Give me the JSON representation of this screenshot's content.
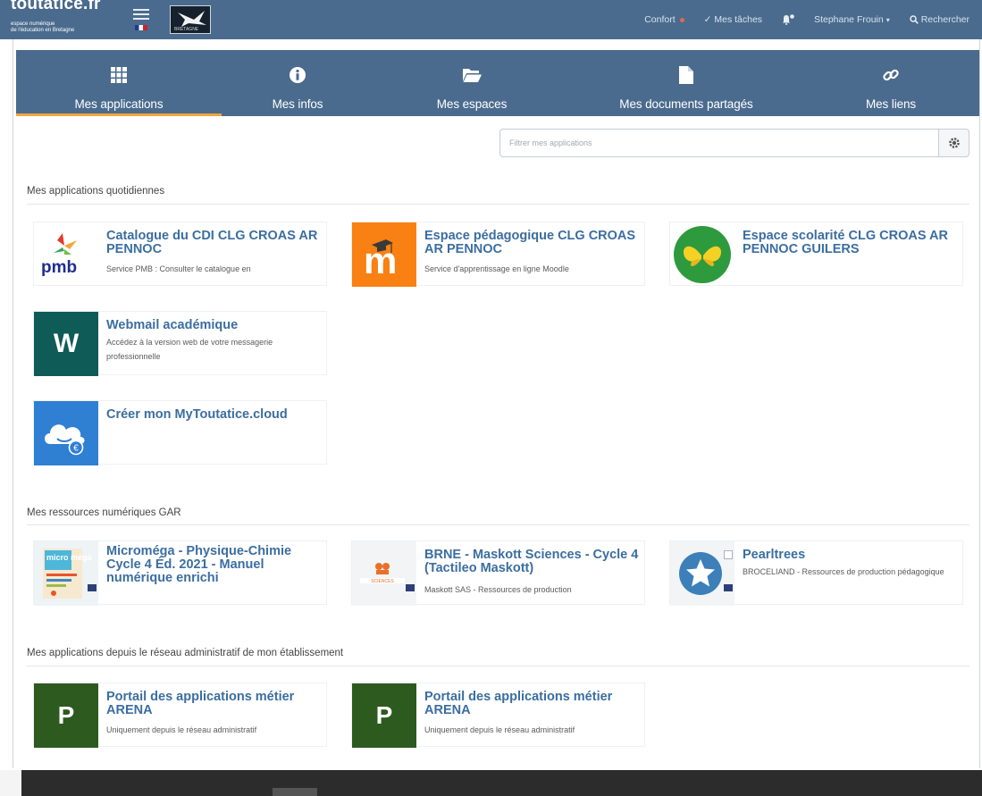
{
  "header": {
    "logo_title": "toutatice.fr",
    "logo_sub1": "espace numérique",
    "logo_sub2": "de l'éducation en Bretagne",
    "bretagne_label": "BRETAGNE",
    "comfort_label": "Confort",
    "tasks_label": "✓ Mes tâches",
    "user_label": "Stephane Frouin",
    "search_label": "Rechercher"
  },
  "tabs": [
    {
      "label": "Mes applications",
      "icon": "grid-icon",
      "active": true
    },
    {
      "label": "Mes infos",
      "icon": "info-icon",
      "active": false
    },
    {
      "label": "Mes espaces",
      "icon": "folder-open-icon",
      "active": false
    },
    {
      "label": "Mes documents partagés",
      "icon": "file-icon",
      "active": false
    },
    {
      "label": "Mes liens",
      "icon": "link-icon",
      "active": false
    }
  ],
  "filter": {
    "placeholder": "Filtrer mes applications"
  },
  "sections": {
    "daily": {
      "title": "Mes applications quotidiennes",
      "cards": [
        {
          "title": "Catalogue du CDI CLG CROAS AR PENNOC",
          "desc": "Service PMB : Consulter le catalogue en",
          "thumb_text": "pmb"
        },
        {
          "title": "Espace pédagogique CLG CROAS AR PENNOC",
          "desc": "Service d'apprentissage en ligne Moodle",
          "thumb_text": "m"
        },
        {
          "title": "Espace scolarité CLG CROAS AR PENNOC GUILERS",
          "desc": "",
          "thumb_text": ""
        },
        {
          "title": "Webmail académique",
          "desc": "Accédez à la version web de votre messagerie professionnelle",
          "thumb_text": "W"
        },
        {
          "title": "Créer mon MyToutatice.cloud",
          "desc": "",
          "thumb_text": "€"
        }
      ]
    },
    "gar": {
      "title": "Mes ressources numériques GAR",
      "cards": [
        {
          "title": "Microméga - Physique-Chimie Cycle 4 Éd. 2021 - Manuel numérique enrichi",
          "desc": "",
          "thumb_text": "micro méga"
        },
        {
          "title": "BRNE - Maskott Sciences - Cycle 4 (Tactileo Maskott)",
          "desc": "Maskott SAS - Ressources de production",
          "thumb_text": "SCIENCES"
        },
        {
          "title": "Pearltrees",
          "desc": "BROCELIAND - Ressources de production pédagogique",
          "thumb_text": ""
        }
      ]
    },
    "admin": {
      "title": "Mes applications depuis le réseau administratif de mon établissement",
      "cards": [
        {
          "title": "Portail des applications métier ARENA",
          "desc": "Uniquement depuis le réseau administratif",
          "thumb_text": "P"
        },
        {
          "title": "Portail des applications métier ARENA",
          "desc": "Uniquement depuis le réseau administratif",
          "thumb_text": "P"
        }
      ]
    }
  },
  "colors": {
    "topbar": "#4a6b8e",
    "active_tab_underline": "#f0a53c",
    "card_title": "#3b6ea0",
    "moodle_orange": "#f98012",
    "webmail_teal": "#0f5b57",
    "cloud_blue": "#2f7fd3",
    "arena_green": "#2d5a1f"
  }
}
